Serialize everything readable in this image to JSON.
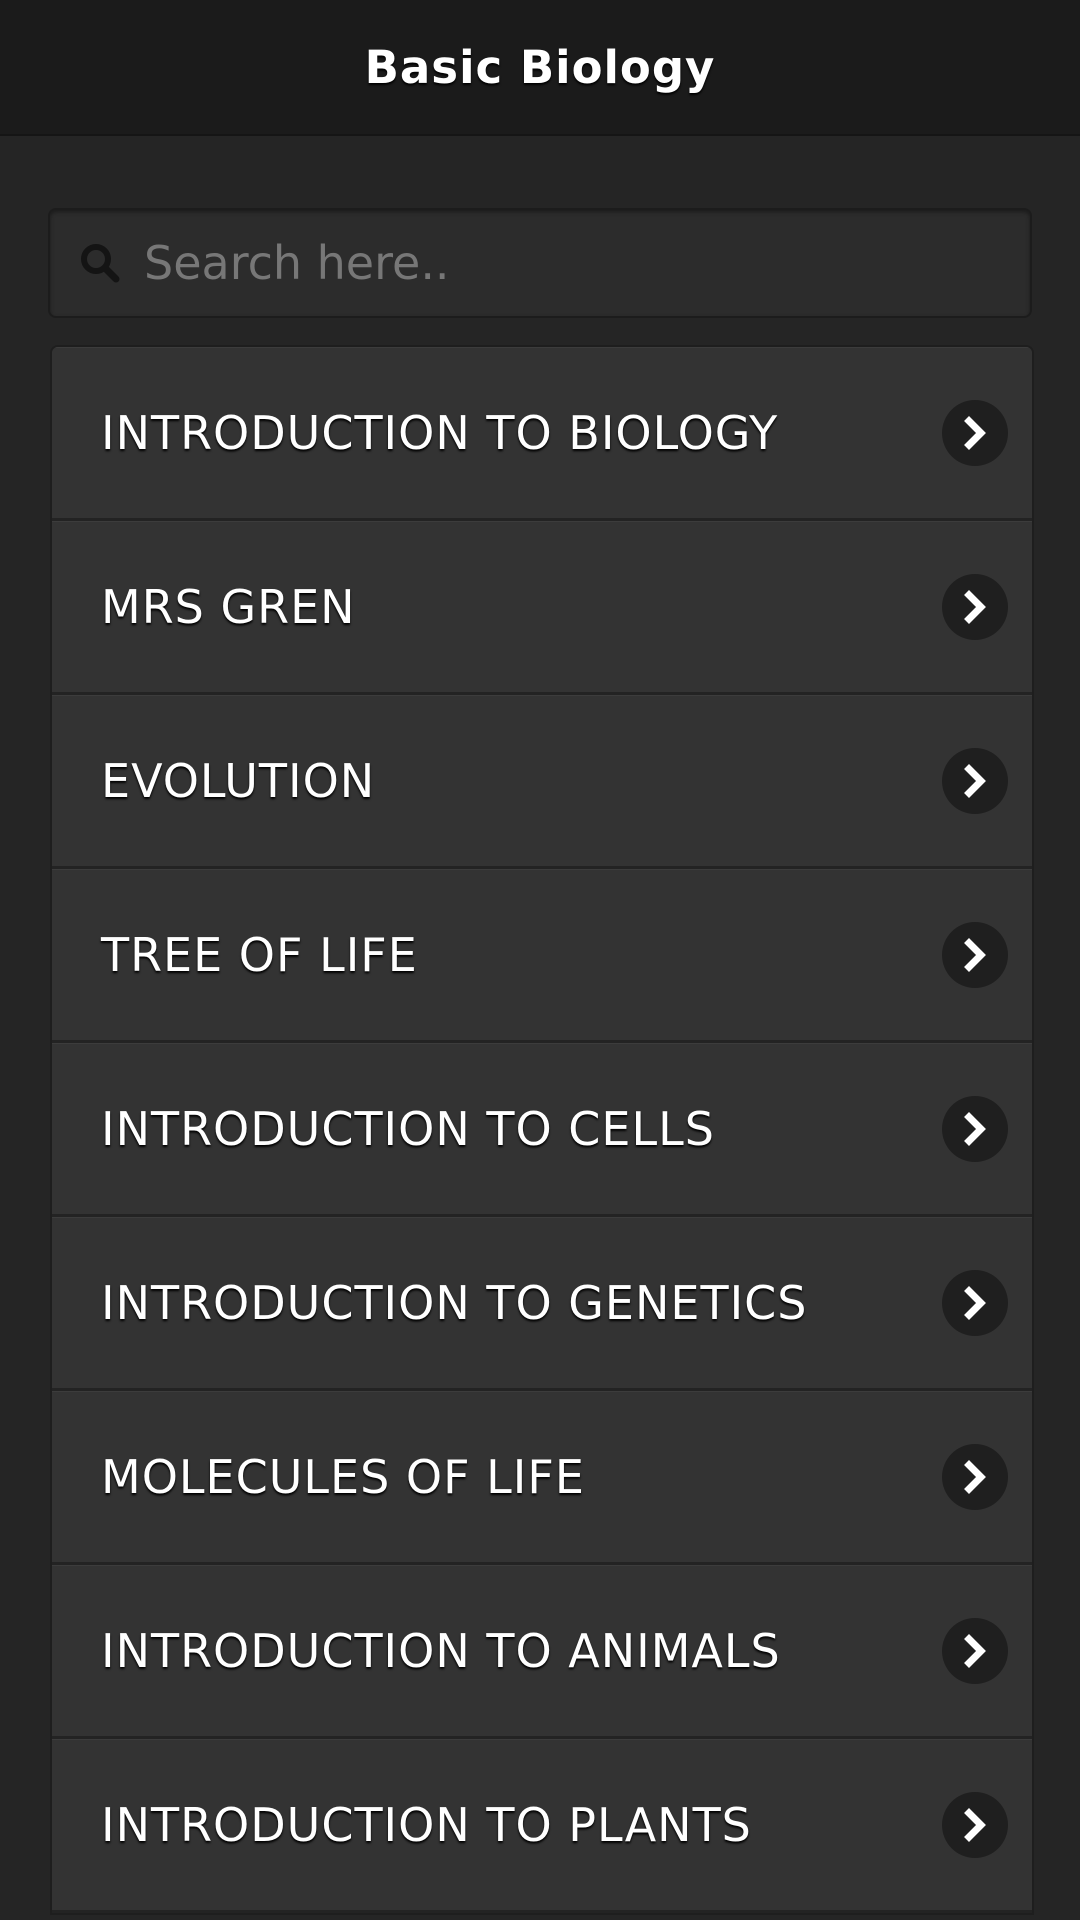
{
  "header": {
    "title": "Basic Biology"
  },
  "search": {
    "placeholder": "Search here..",
    "value": "",
    "icon": "search-icon"
  },
  "topics": [
    {
      "label": "INTRODUCTION TO BIOLOGY",
      "icon": "chevron-right-icon"
    },
    {
      "label": "MRS GREN",
      "icon": "chevron-right-icon"
    },
    {
      "label": "EVOLUTION",
      "icon": "chevron-right-icon"
    },
    {
      "label": "TREE OF LIFE",
      "icon": "chevron-right-icon"
    },
    {
      "label": "INTRODUCTION TO CELLS",
      "icon": "chevron-right-icon"
    },
    {
      "label": "INTRODUCTION TO GENETICS",
      "icon": "chevron-right-icon"
    },
    {
      "label": "MOLECULES OF LIFE",
      "icon": "chevron-right-icon"
    },
    {
      "label": "INTRODUCTION TO ANIMALS",
      "icon": "chevron-right-icon"
    },
    {
      "label": "INTRODUCTION TO PLANTS",
      "icon": "chevron-right-icon"
    }
  ],
  "colors": {
    "header_background": "#1b1b1b",
    "page_background": "#252525",
    "list_item_background": "#333333",
    "text": "#ffffff",
    "chevron_background": "#1f1f1f"
  }
}
